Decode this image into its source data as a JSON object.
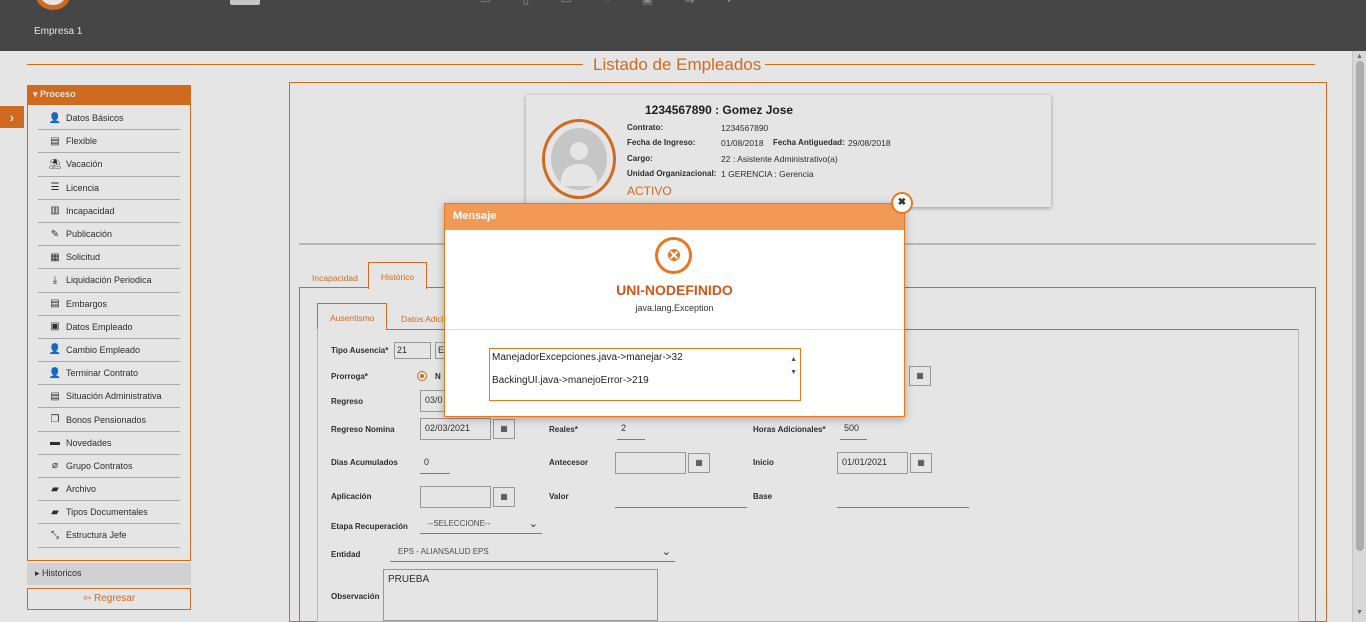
{
  "header": {
    "empresa": "Empresa 1"
  },
  "page": {
    "title": "Listado de Empleados"
  },
  "sidebar": {
    "section_title": "Proceso",
    "items": [
      {
        "label": "Datos Básicos",
        "icon": "user-icon"
      },
      {
        "label": "Flexible",
        "icon": "money-icon"
      },
      {
        "label": "Vacación",
        "icon": "beach-icon"
      },
      {
        "label": "Licencia",
        "icon": "list-icon"
      },
      {
        "label": "Incapacidad",
        "icon": "books-icon"
      },
      {
        "label": "Publicación",
        "icon": "pen-icon"
      },
      {
        "label": "Solicitud",
        "icon": "form-icon"
      },
      {
        "label": "Liquidación Periodica",
        "icon": "download-icon"
      },
      {
        "label": "Embargos",
        "icon": "table-icon"
      },
      {
        "label": "Datos Empleado",
        "icon": "id-card-icon"
      },
      {
        "label": "Cambio Empleado",
        "icon": "user-swap-icon"
      },
      {
        "label": "Terminar Contrato",
        "icon": "user-remove-icon"
      },
      {
        "label": "Situación Administrativa",
        "icon": "document-icon"
      },
      {
        "label": "Bonos Pensionados",
        "icon": "copy-icon"
      },
      {
        "label": "Novedades",
        "icon": "comment-icon"
      },
      {
        "label": "Grupo Contratos",
        "icon": "paperclip-icon"
      },
      {
        "label": "Archivo",
        "icon": "folder-open-icon"
      },
      {
        "label": "Tipos Documentales",
        "icon": "folder-icon"
      },
      {
        "label": "Estructura Jefe",
        "icon": "compress-icon"
      }
    ],
    "historicos": "Historicos",
    "regresar": "Regresar"
  },
  "employee": {
    "name": "1234567890 : Gomez Jose",
    "contrato_label": "Contrato:",
    "contrato": "1234567890",
    "ingreso_label": "Fecha de Ingreso:",
    "ingreso": "01/08/2018",
    "antiguedad_label": "Fecha Antiguedad:",
    "antiguedad": "29/08/2018",
    "cargo_label": "Cargo:",
    "cargo": "22 : Asistente Administrativo(a)",
    "unidad_label": "Unidad Organizacional:",
    "unidad": "1 GERENCIA : Gerencia",
    "status": "ACTIVO"
  },
  "tabs": {
    "outer": [
      "Incapacidad",
      "Histórico"
    ],
    "inner": [
      "Ausentismo",
      "Datos Adici"
    ]
  },
  "form": {
    "tipo_ausencia_label": "Tipo Ausencia*",
    "tipo_ausencia_value": "21",
    "tipo_ausencia_value2": "E",
    "prorroga_label": "Prorroga*",
    "prorroga_option": "N",
    "regreso_label": "Regreso",
    "regreso_value": "03/0",
    "regreso_nomina_label": "Regreso Nomina",
    "regreso_nomina_value": "02/03/2021",
    "reales_label": "Reales*",
    "reales_value": "2",
    "horas_label": "Horas Adicionales*",
    "horas_value": "500",
    "dias_label": "Dias Acumulados",
    "dias_value": "0",
    "antecesor_label": "Antecesor",
    "inicio_label": "Inicio",
    "inicio_value": "01/01/2021",
    "aplicacion_label": "Aplicación",
    "valor_label": "Valor",
    "base_label": "Base",
    "etapa_label": "Etapa Recuperación",
    "etapa_value": "--SELECCIONE--",
    "entidad_label": "Entidad",
    "entidad_value": "EPS - ALIANSALUD EPS",
    "observacion_label": "Observación",
    "observacion_value": "PRUEBA"
  },
  "modal": {
    "title": "Mensaje",
    "error_code": "UNI-NODEFINIDO",
    "exception": "java.lang.Exception",
    "trace": [
      "ManejadorExcepciones.java->manejar->32",
      "BackingUI.java->manejoError->219"
    ]
  },
  "colors": {
    "accent": "#e87722",
    "topbar": "#4f4f4f",
    "modal_header": "#f29a55",
    "error_text": "#d4541a"
  }
}
